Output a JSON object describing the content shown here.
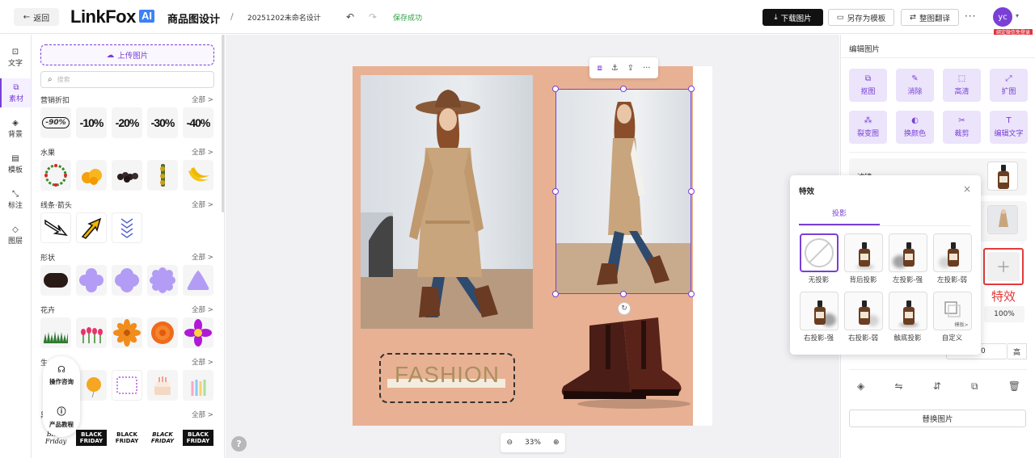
{
  "topbar": {
    "back_label": "返回",
    "logo_main": "LinkFox",
    "logo_ai": "AI",
    "app_title": "商品图设计",
    "separator": "/",
    "doc_name": "20251202未命名设计",
    "save_status": "保存成功",
    "download_label": "下载图片",
    "save_template_label": "另存为模板",
    "translate_label": "整图翻译",
    "more_label": "···",
    "avatar_initials": "yc",
    "login_badge": "绑定微信免登录"
  },
  "rail": {
    "items": [
      {
        "label": "文字",
        "icon": "text-icon",
        "glyph": "⊡"
      },
      {
        "label": "素材",
        "icon": "material-icon",
        "glyph": "⧉"
      },
      {
        "label": "背景",
        "icon": "background-icon",
        "glyph": "◈"
      },
      {
        "label": "模板",
        "icon": "template-icon",
        "glyph": "▤"
      },
      {
        "label": "标注",
        "icon": "annotation-icon",
        "glyph": "⤡"
      },
      {
        "label": "图层",
        "icon": "layers-icon",
        "glyph": "◇"
      }
    ]
  },
  "materials": {
    "upload_label": "上传图片",
    "search_placeholder": "搜索",
    "see_all": "全部 >",
    "categories": [
      {
        "title": "营销折扣",
        "items": [
          "-90%",
          "-10%",
          "-20%",
          "-30%",
          "-40%"
        ]
      },
      {
        "title": "水果"
      },
      {
        "title": "线条·箭头"
      },
      {
        "title": "形状"
      },
      {
        "title": "花卉"
      },
      {
        "title": "生"
      },
      {
        "title": "黑",
        "items": [
          "Black Friday",
          "BLACK FRIDAY",
          "BLACK FRIDAY",
          "BLACK FRIDAY",
          "BLACK FRIDAY"
        ]
      }
    ],
    "help_consult": "操作咨询",
    "help_tutorial": "产品教程"
  },
  "canvas": {
    "fashion_text": "FASHION",
    "zoom_level": "33%",
    "zoom_out": "⊖",
    "zoom_in": "⊕",
    "help": "?"
  },
  "right_panel": {
    "title": "编辑图片",
    "tools": [
      "抠图",
      "消除",
      "高清",
      "扩图",
      "裂变图",
      "换颜色",
      "裁剪",
      "编辑文字"
    ],
    "filter_label": "滤镜",
    "effect_label": "特效",
    "opacity": "100%",
    "height_value": "0",
    "height_label": "高",
    "replace_label": "替换图片"
  },
  "effect_popup": {
    "title": "特效",
    "close": "×",
    "tab": "投影",
    "options": [
      "无投影",
      "背后投影",
      "左投影-强",
      "左投影-弱",
      "右投影-强",
      "右投影-弱",
      "触底投影",
      "自定义"
    ],
    "custom_sub": "模板>"
  },
  "colors": {
    "accent": "#7a3fd6",
    "artboard": "#e8b193",
    "highlight": "#e23b3b",
    "success": "#2ea043"
  }
}
